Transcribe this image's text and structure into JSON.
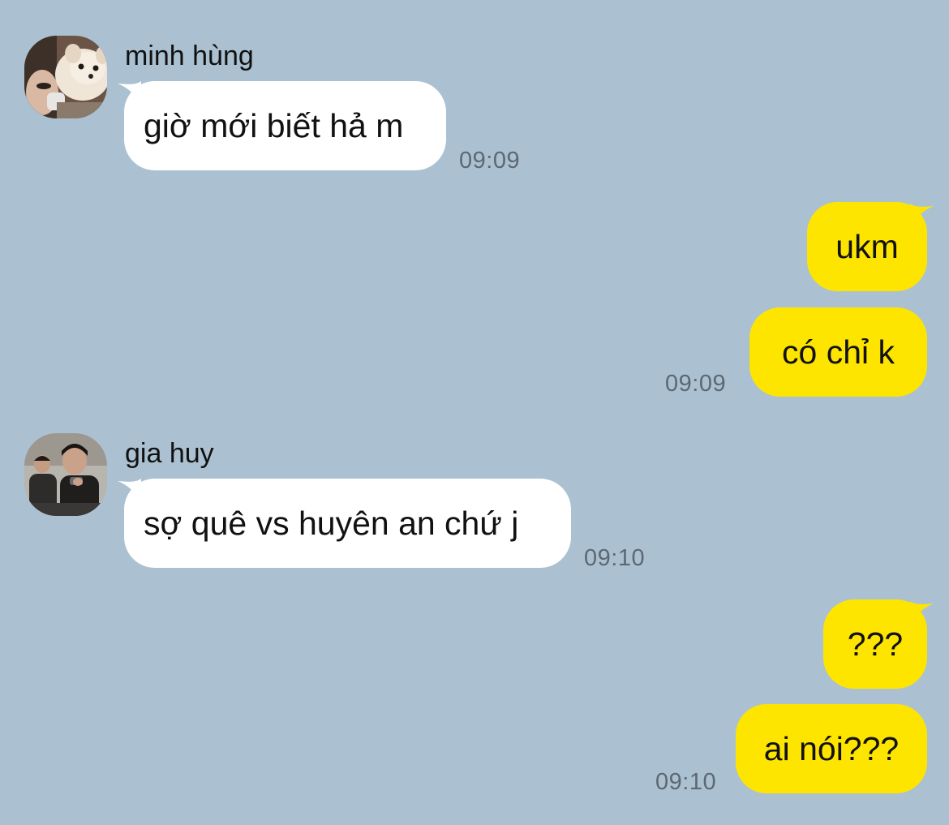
{
  "colors": {
    "background": "#abc1d1",
    "incoming_bubble": "#ffffff",
    "outgoing_bubble": "#fee500",
    "timestamp": "#5c6873"
  },
  "messages": {
    "m1": {
      "sender": "minh hùng",
      "text": "giờ mới biết hả m",
      "time": "09:09"
    },
    "o1": {
      "text": "ukm"
    },
    "o2": {
      "text": "có chỉ k",
      "time": "09:09"
    },
    "m2": {
      "sender": "gia huy",
      "text": "sợ quê vs huyên an chứ j",
      "time": "09:10"
    },
    "o3": {
      "text": "???"
    },
    "o4": {
      "text": "ai nói???",
      "time": "09:10"
    }
  }
}
